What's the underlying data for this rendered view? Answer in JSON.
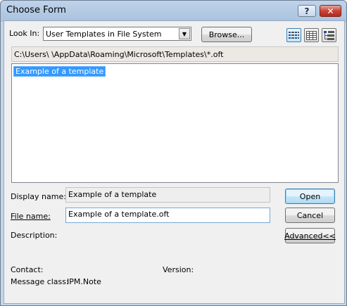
{
  "window": {
    "title": "Choose Form",
    "help_glyph": "?",
    "close_glyph": "✕"
  },
  "look_in": {
    "label": "Look In:",
    "value": "User Templates in File System",
    "arrow": "▼"
  },
  "browse_label": "Browse...",
  "view_buttons": [
    {
      "icon": "list-view-icon"
    },
    {
      "icon": "details-view-icon"
    },
    {
      "icon": "tree-view-icon"
    }
  ],
  "path": "C:\\Users\\            \\AppData\\Roaming\\Microsoft\\Templates\\*.oft",
  "form_list": {
    "items": [
      "Example of a template"
    ],
    "selected_index": 0
  },
  "display_name": {
    "label": "Display name:",
    "value": "Example of a template"
  },
  "file_name": {
    "label": "File name:",
    "value": "Example of a template.oft"
  },
  "description": {
    "label": "Description:"
  },
  "buttons": {
    "open": "Open",
    "cancel": "Cancel",
    "advanced": "Advanced<<"
  },
  "contact_label": "Contact:",
  "version_label": "Version:",
  "message_class": {
    "label": "Message class:",
    "value": "IPM.Note"
  }
}
